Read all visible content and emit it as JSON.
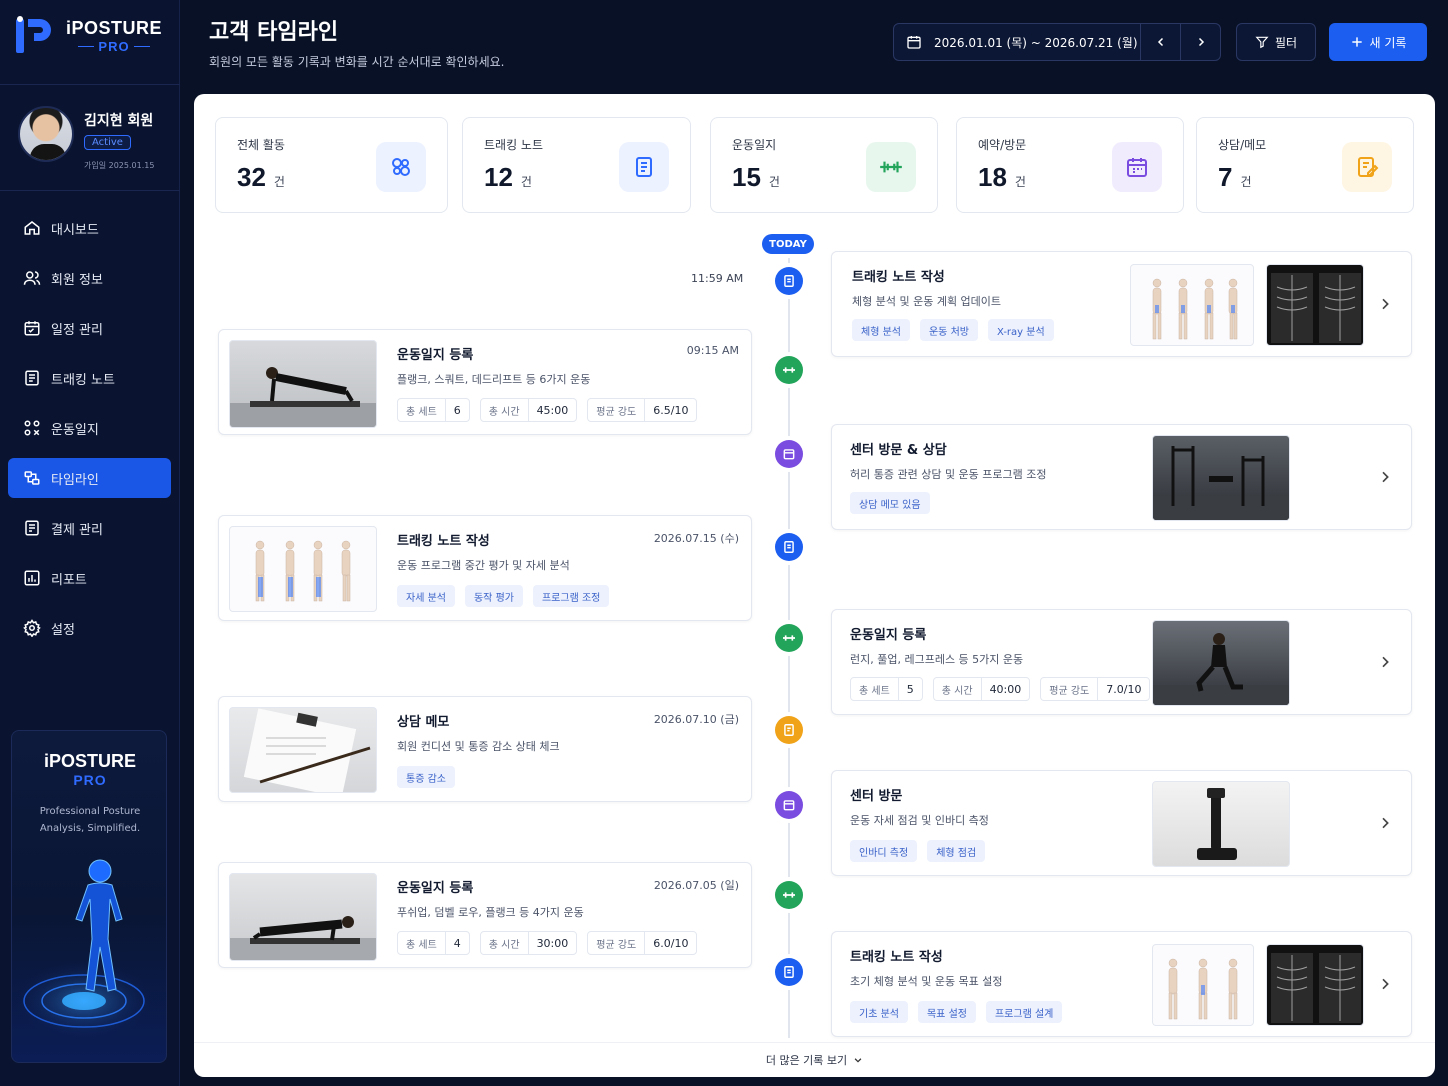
{
  "app": {
    "brand_top": "iPOSTURE",
    "brand_bottom": "PRO"
  },
  "profile": {
    "name": "김지현 회원",
    "status": "Active",
    "joined": "가입일 2025.01.15"
  },
  "nav": [
    {
      "label": "대시보드",
      "icon": "home-icon"
    },
    {
      "label": "회원 정보",
      "icon": "users-icon"
    },
    {
      "label": "일정 관리",
      "icon": "calendar-icon"
    },
    {
      "label": "트래킹 노트",
      "icon": "note-icon"
    },
    {
      "label": "운동일지",
      "icon": "exercise-icon"
    },
    {
      "label": "타임라인",
      "icon": "timeline-icon",
      "active": true
    },
    {
      "label": "결제 관리",
      "icon": "payment-icon"
    },
    {
      "label": "리포트",
      "icon": "report-icon"
    },
    {
      "label": "설정",
      "icon": "settings-icon"
    }
  ],
  "promo": {
    "brand_top": "iPOSTURE",
    "brand_bottom": "PRO",
    "desc1": "Professional Posture",
    "desc2": "Analysis, Simplified."
  },
  "header": {
    "title": "고객 타임라인",
    "subtitle": "회원의 모든 활동 기록과 변화를 시간 순서대로 확인하세요.",
    "date_range": "2026.01.01 (목) ~ 2026.07.21 (월)",
    "filter_label": "필터",
    "new_label": "새 기록"
  },
  "stats": [
    {
      "label": "전체 활동",
      "value": "32",
      "unit": "건",
      "icon": "activity-icon",
      "color": "#2f6bff",
      "bg": "#ecf2ff"
    },
    {
      "label": "트래킹 노트",
      "value": "12",
      "unit": "건",
      "icon": "note-icon",
      "color": "#2f6bff",
      "bg": "#ecf2ff"
    },
    {
      "label": "운동일지",
      "value": "15",
      "unit": "건",
      "icon": "dumbbell-icon",
      "color": "#22a45a",
      "bg": "#e7f7ee"
    },
    {
      "label": "예약/방문",
      "value": "18",
      "unit": "건",
      "icon": "calendar-icon",
      "color": "#7a4ce0",
      "bg": "#f1ecfd"
    },
    {
      "label": "상담/메모",
      "value": "7",
      "unit": "건",
      "icon": "memo-icon",
      "color": "#f0a318",
      "bg": "#fff5e3"
    }
  ],
  "timeline": {
    "today_label": "TODAY",
    "now_time": "11:59 AM",
    "more_label": "더 많은 기록 보기",
    "right": [
      {
        "title": "트래킹 노트 작성",
        "desc": "체형 분석 및 운동 계획 업데이트",
        "tags": [
          "체형 분석",
          "운동 처방",
          "X-ray 분석"
        ]
      },
      {
        "title": "센터 방문 & 상담",
        "desc": "허리 통증 관련 상담 및 운동 프로그램 조정",
        "tags": [
          "상담 메모 있음"
        ]
      },
      {
        "title": "운동일지 등록",
        "desc": "런지, 풀업, 레그프레스 등 5가지 운동",
        "metrics": [
          {
            "k": "총 세트",
            "v": "5"
          },
          {
            "k": "총 시간",
            "v": "40:00"
          },
          {
            "k": "평균 강도",
            "v": "7.0/10"
          }
        ]
      },
      {
        "title": "센터 방문",
        "desc": "운동 자세 점검 및 인바디 측정",
        "tags": [
          "인바디 측정",
          "체형 점검"
        ]
      },
      {
        "title": "트래킹 노트 작성",
        "desc": "초기 체형 분석 및 운동 목표 설정",
        "tags": [
          "기초 분석",
          "목표 설정",
          "프로그램 설계"
        ]
      }
    ],
    "left": [
      {
        "title": "운동일지 등록",
        "date": "09:15 AM",
        "desc": "플랭크, 스쿼트, 데드리프트 등 6가지 운동",
        "metrics": [
          {
            "k": "총 세트",
            "v": "6"
          },
          {
            "k": "총 시간",
            "v": "45:00"
          },
          {
            "k": "평균 강도",
            "v": "6.5/10"
          }
        ]
      },
      {
        "title": "트래킹 노트 작성",
        "date": "2026.07.15 (수)",
        "desc": "운동 프로그램 중간 평가 및 자세 분석",
        "tags": [
          "자세 분석",
          "동작 평가",
          "프로그램 조정"
        ]
      },
      {
        "title": "상담 메모",
        "date": "2026.07.10 (금)",
        "desc": "회원 컨디션 및 통증 감소 상태 체크",
        "tags": [
          "통증 감소"
        ]
      },
      {
        "title": "운동일지 등록",
        "date": "2026.07.05 (일)",
        "desc": "푸쉬업, 덤벨 로우, 플랭크 등 4가지 운동",
        "metrics": [
          {
            "k": "총 세트",
            "v": "4"
          },
          {
            "k": "총 시간",
            "v": "30:00"
          },
          {
            "k": "평균 강도",
            "v": "6.0/10"
          }
        ]
      }
    ]
  }
}
